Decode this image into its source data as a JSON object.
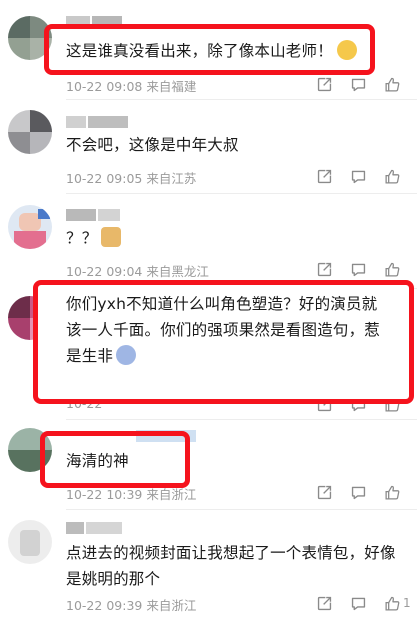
{
  "comments": [
    {
      "text": "这是谁真没看出来，除了像本山老师！",
      "emoji": "laughing-tears-emoji",
      "date": "10-22",
      "time": "09:08",
      "location": "来自福建",
      "highlighted": true
    },
    {
      "text": "不会吧，这像是中年大叔",
      "date": "10-22",
      "time": "09:05",
      "location": "来自江苏",
      "highlighted": false
    },
    {
      "text": "？？",
      "emoji": "doge-emoji",
      "date": "10-22",
      "time": "09:04",
      "location": "来自黑龙江",
      "highlighted": false
    },
    {
      "text": "你们yxh不知道什么叫角色塑造？好的演员就该一人千面。你们的强项果然是看图造句，惹是生非",
      "emoji": "shocked-face-emoji",
      "date": "10-22",
      "time": "",
      "location": "",
      "highlighted": true
    },
    {
      "text": "海清的神",
      "date": "10-22",
      "time": "10:39",
      "location": "来自浙江",
      "highlighted": true
    },
    {
      "text": "点进去的视频封面让我想起了一个表情包，好像是姚明的那个",
      "date": "10-22",
      "time": "09:39",
      "location": "来自浙江",
      "likes": "1",
      "highlighted": false
    }
  ],
  "icons": {
    "share": "share-icon",
    "comment": "comment-icon",
    "like": "thumbs-up-icon"
  },
  "colors": {
    "highlight_border": "#f5131d",
    "meta_text": "#9b9b9b",
    "body_text": "#1a1a1a"
  }
}
